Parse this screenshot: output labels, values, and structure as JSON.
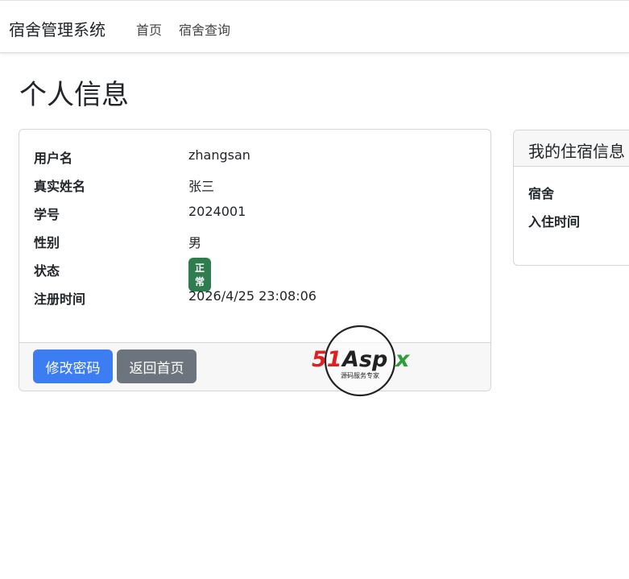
{
  "navbar": {
    "brand": "宿舍管理系统",
    "links": [
      "首页",
      "宿舍查询"
    ]
  },
  "page": {
    "title": "个人信息"
  },
  "profile": {
    "rows": [
      {
        "label": "用户名",
        "value": "zhangsan"
      },
      {
        "label": "真实姓名",
        "value": "张三"
      },
      {
        "label": "学号",
        "value": "2024001"
      },
      {
        "label": "性别",
        "value": "男"
      },
      {
        "label": "状态",
        "value": "正常"
      },
      {
        "label": "注册时间",
        "value": "2026/4/25 23:08:06"
      }
    ],
    "buttons": {
      "change_password": "修改密码",
      "back_home": "返回首页"
    }
  },
  "side": {
    "title": "我的住宿信息",
    "rows": [
      {
        "label": "宿舍"
      },
      {
        "label": "入住时间"
      }
    ]
  },
  "logo": {
    "main": "51Aspx",
    "tagline": "源码服务专家"
  },
  "colors": {
    "primary": "#3d7df4",
    "secondary": "#6c757d",
    "success": "#2f7d4f",
    "logo_red": "#e02020",
    "logo_green": "#2e9e3a"
  }
}
